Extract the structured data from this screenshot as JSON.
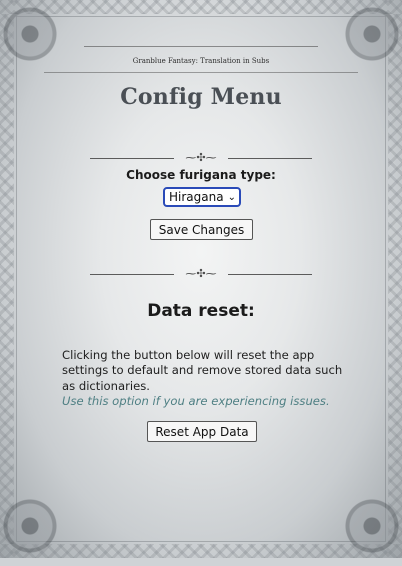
{
  "header": {
    "banner_text": "Granblue Fantasy: Translation in Subs",
    "title": "Config Menu"
  },
  "furigana": {
    "label": "Choose furigana type:",
    "selected": "Hiragana",
    "save_label": "Save Changes"
  },
  "reset": {
    "heading": "Data reset:",
    "description": "Clicking the button below will reset the app settings to default and remove stored data such as dictionaries.",
    "hint": "Use this option if you are experiencing issues.",
    "button_label": "Reset App Data"
  },
  "colors": {
    "select_border": "#2a4ab8",
    "hint_text": "#4e7f83",
    "title_text": "#4a4f55"
  }
}
